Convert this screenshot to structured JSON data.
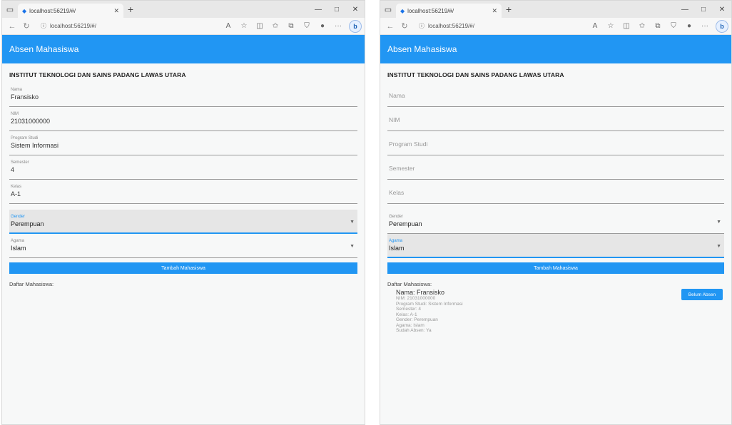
{
  "left": {
    "tab_title": "localhost:56219/#/",
    "url": "localhost:56219/#/",
    "app_title": "Absen Mahasiswa",
    "institution": "INSTITUT TEKNOLOGI DAN SAINS PADANG LAWAS UTARA",
    "fields": [
      {
        "label": "Nama",
        "value": "Fransisko"
      },
      {
        "label": "NIM",
        "value": "21031000000"
      },
      {
        "label": "Program Studi",
        "value": "Sistem Informasi"
      },
      {
        "label": "Semester",
        "value": "4"
      },
      {
        "label": "Kelas",
        "value": "A-1"
      }
    ],
    "gender": {
      "label": "Gender",
      "value": "Perempuan"
    },
    "agama": {
      "label": "Agama",
      "value": "Islam"
    },
    "add_button": "Tambah Mahasiswa",
    "list_title": "Daftar Mahasiswa:"
  },
  "right": {
    "tab_title": "localhost:56219/#/",
    "url": "localhost:56219/#/",
    "app_title": "Absen Mahasiswa",
    "institution": "INSTITUT TEKNOLOGI DAN SAINS PADANG LAWAS UTARA",
    "fields": [
      {
        "placeholder": "Nama"
      },
      {
        "placeholder": "NIM"
      },
      {
        "placeholder": "Program Studi"
      },
      {
        "placeholder": "Semester"
      },
      {
        "placeholder": "Kelas"
      }
    ],
    "gender": {
      "label": "Gender",
      "value": "Perempuan"
    },
    "agama": {
      "label": "Agama",
      "value": "Islam"
    },
    "add_button": "Tambah Mahasiswa",
    "list_title": "Daftar Mahasiswa:",
    "student": {
      "name": "Nama: Fransisko",
      "lines": [
        "NIM: 21031000000",
        "Program Studi: Sistem Informasi",
        "Semester: 4",
        "Kelas: A-1",
        "Gender: Perempuan",
        "Agama: Islam",
        "Sudah Absen: Ya"
      ],
      "button": "Belum Absen"
    }
  },
  "icons": {
    "window_menu": "window-menu-icon",
    "back": "back-arrow-icon",
    "refresh": "refresh-icon",
    "info": "info-icon",
    "read_aloud": "read-aloud-icon",
    "favorite": "star-icon",
    "split": "split-screen-icon",
    "favorites": "favorites-icon",
    "collections": "collections-icon",
    "shield": "shield-icon",
    "profile": "profile-icon",
    "more": "more-icon",
    "edge": "edge-copilot-icon"
  },
  "colors": {
    "accent": "#2196f3"
  }
}
